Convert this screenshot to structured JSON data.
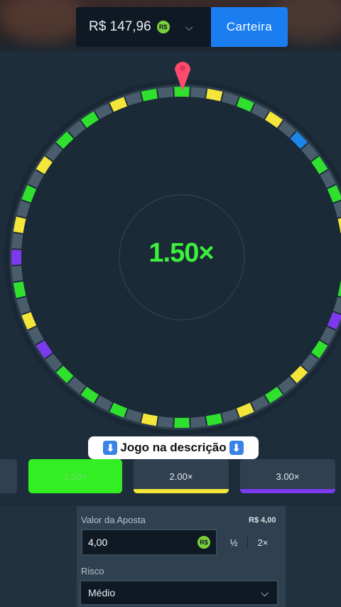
{
  "header": {
    "balance": "R$ 147,96",
    "coin_label": "R$",
    "wallet_button": "Carteira"
  },
  "wheel": {
    "multiplier_display": "1.50×",
    "segment_colors": {
      "green": "#2fe02f",
      "yellow": "#f3e53a",
      "blue": "#1c86e8",
      "purple": "#7c3aed",
      "gray": "#4a5d6c"
    },
    "segments": [
      "g",
      "s",
      "y",
      "s",
      "g",
      "s",
      "y",
      "s",
      "b",
      "s",
      "g",
      "s",
      "g",
      "s",
      "y",
      "s",
      "g",
      "s",
      "g",
      "s",
      "p",
      "s",
      "g",
      "s",
      "y",
      "s",
      "g",
      "s",
      "y",
      "s",
      "g",
      "s",
      "g",
      "s",
      "y",
      "s",
      "g",
      "s",
      "g",
      "s",
      "g",
      "s",
      "p",
      "s",
      "y",
      "s",
      "g",
      "s",
      "p",
      "s",
      "y",
      "s",
      "g",
      "s",
      "y",
      "s",
      "g",
      "s",
      "g",
      "s",
      "y",
      "s",
      "g",
      "s"
    ]
  },
  "caption": {
    "text": "Jogo na descrição",
    "arrow": "⬇"
  },
  "multipliers": [
    {
      "label": "",
      "bar_color": ""
    },
    {
      "label": "1.50×",
      "bar_color": ""
    },
    {
      "label": "2.00×",
      "bar_color": "#f3e53a"
    },
    {
      "label": "3.00×",
      "bar_color": "#7c3aed"
    }
  ],
  "bet": {
    "label": "Valor da Aposta",
    "amount_display": "R$ 4,00",
    "value": "4,00",
    "coin_label": "R$",
    "half_label": "½",
    "double_label": "2×"
  },
  "risk": {
    "label": "Risco",
    "value": "Médio"
  }
}
